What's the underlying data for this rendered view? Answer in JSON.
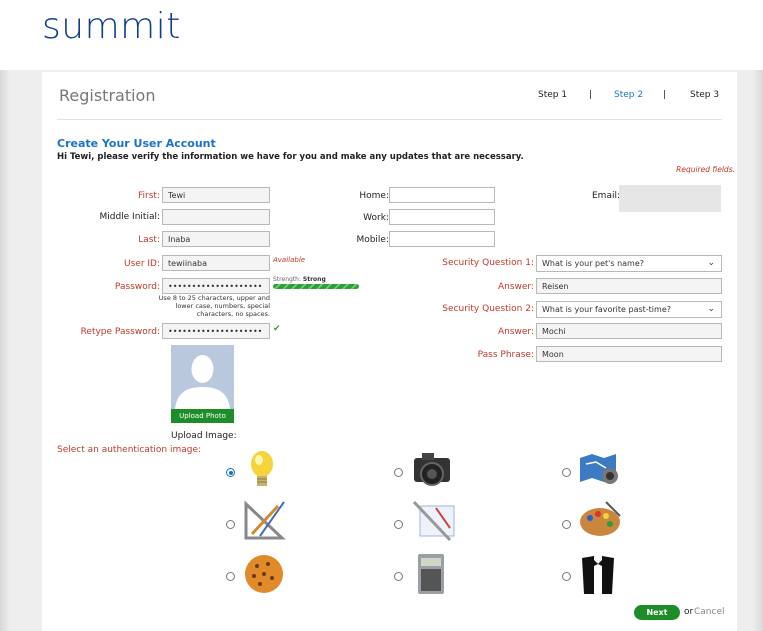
{
  "brand": {
    "logo_text": "summit",
    "color": "#0e3d8c"
  },
  "header": {
    "title": "Registration",
    "steps": [
      {
        "label": "Step 1",
        "active": false
      },
      {
        "label": "Step 2",
        "active": true
      },
      {
        "label": "Step 3",
        "active": false
      }
    ],
    "separator": "|"
  },
  "section": {
    "title": "Create Your User Account",
    "intro": "Hi Tewi, please verify the information we have for you and make any updates that are necessary.",
    "required_note": "Required fields."
  },
  "form": {
    "first": {
      "label": "First:",
      "value": "Tewi"
    },
    "middle": {
      "label": "Middle Initial:",
      "value": ""
    },
    "last": {
      "label": "Last:",
      "value": "Inaba"
    },
    "user_id": {
      "label": "User ID:",
      "value": "tewiinaba",
      "status": "Available"
    },
    "password": {
      "label": "Password:",
      "value": "••••••••••••••••••••",
      "strength_label": "Strength:",
      "strength_value": "Strong",
      "strength_level": 1.0,
      "hint": "Use 8 to 25 characters, upper and lower case, numbers, special characters, no spaces."
    },
    "retype_password": {
      "label": "Retype Password:",
      "value": "••••••••••••••••••••",
      "match_icon": "check-icon"
    },
    "home": {
      "label": "Home:",
      "value": ""
    },
    "work": {
      "label": "Work:",
      "value": ""
    },
    "mobile": {
      "label": "Mobile:",
      "value": ""
    },
    "email": {
      "label": "Email:",
      "value": ""
    },
    "security_q1": {
      "label": "Security Question 1:",
      "value": "What is your pet's name?"
    },
    "answer1": {
      "label": "Answer:",
      "value": "Reisen"
    },
    "security_q2": {
      "label": "Security Question 2:",
      "value": "What is your favorite past-time?"
    },
    "answer2": {
      "label": "Answer:",
      "value": "Mochi"
    },
    "pass_phrase": {
      "label": "Pass Phrase:",
      "value": "Moon"
    }
  },
  "photo": {
    "upload_button": "Upload Photo",
    "upload_label": "Upload Image:"
  },
  "auth_images": {
    "label": "Select an authentication image:",
    "options": [
      {
        "icon": "lightbulb-icon",
        "selected": true
      },
      {
        "icon": "camera-icon",
        "selected": false
      },
      {
        "icon": "map-camera-icon",
        "selected": false
      },
      {
        "icon": "drafting-tools-icon",
        "selected": false
      },
      {
        "icon": "drafting-paper-icon",
        "selected": false
      },
      {
        "icon": "paint-palette-icon",
        "selected": false
      },
      {
        "icon": "cookie-icon",
        "selected": false
      },
      {
        "icon": "calculator-icon",
        "selected": false
      },
      {
        "icon": "tuxedo-icon",
        "selected": false
      }
    ]
  },
  "actions": {
    "next": "Next",
    "or": "or",
    "cancel": "Cancel"
  },
  "colors": {
    "accent": "#1a73c9",
    "required": "#c0392b",
    "button": "#1d8d2a"
  }
}
